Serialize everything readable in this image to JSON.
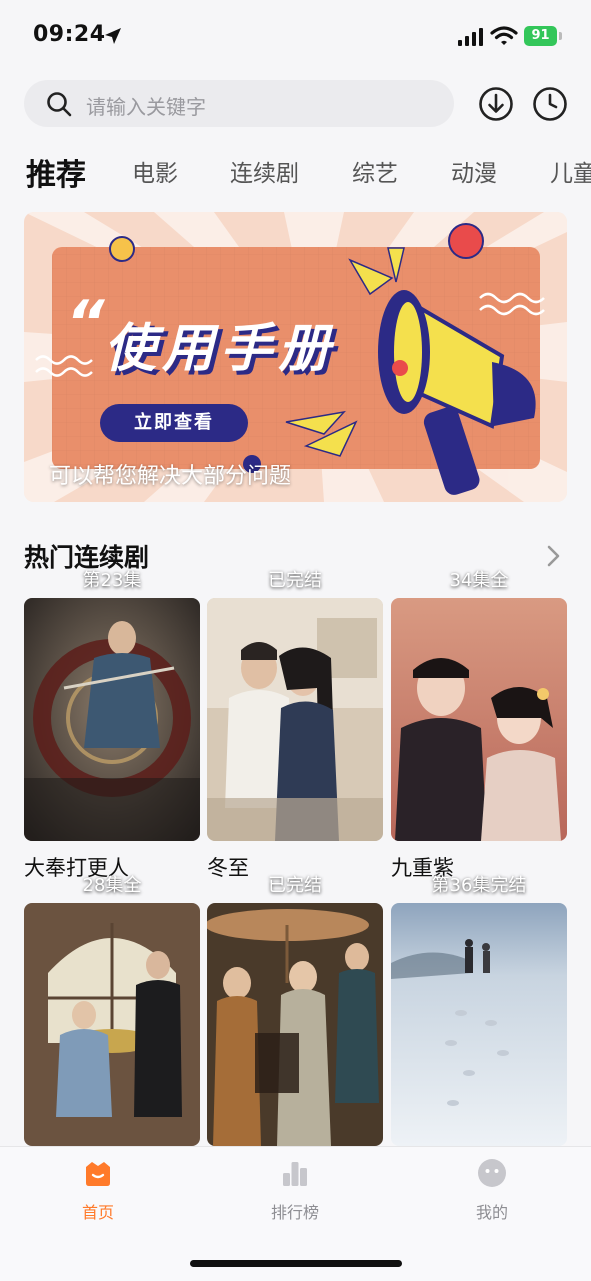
{
  "status_bar": {
    "time": "09:24",
    "battery": "91"
  },
  "search": {
    "placeholder": "请输入关键字"
  },
  "tabs": [
    {
      "label": "推荐",
      "active": true
    },
    {
      "label": "电影"
    },
    {
      "label": "连续剧"
    },
    {
      "label": "综艺"
    },
    {
      "label": "动漫"
    },
    {
      "label": "儿童"
    }
  ],
  "banner": {
    "quote_mark": "“",
    "title": "使用手册",
    "button_label": "立即查看",
    "caption": "可以帮您解决大部分问题"
  },
  "section": {
    "title": "热门连续剧"
  },
  "cards": [
    {
      "title": "大奉打更人",
      "episode": "第23集"
    },
    {
      "title": "冬至",
      "episode": "已完结"
    },
    {
      "title": "九重紫",
      "episode": "34集全"
    },
    {
      "title": "",
      "episode": "28集全"
    },
    {
      "title": "",
      "episode": "已完结"
    },
    {
      "title": "",
      "episode": "第36集完结"
    }
  ],
  "bottom_nav": [
    {
      "label": "首页",
      "icon": "home-icon",
      "active": true
    },
    {
      "label": "排行榜",
      "icon": "ranking-icon"
    },
    {
      "label": "我的",
      "icon": "profile-icon"
    }
  ],
  "colors": {
    "accent": "#ff7a2a",
    "banner_navy": "#2c2a86",
    "banner_yellow": "#f4e04d"
  }
}
